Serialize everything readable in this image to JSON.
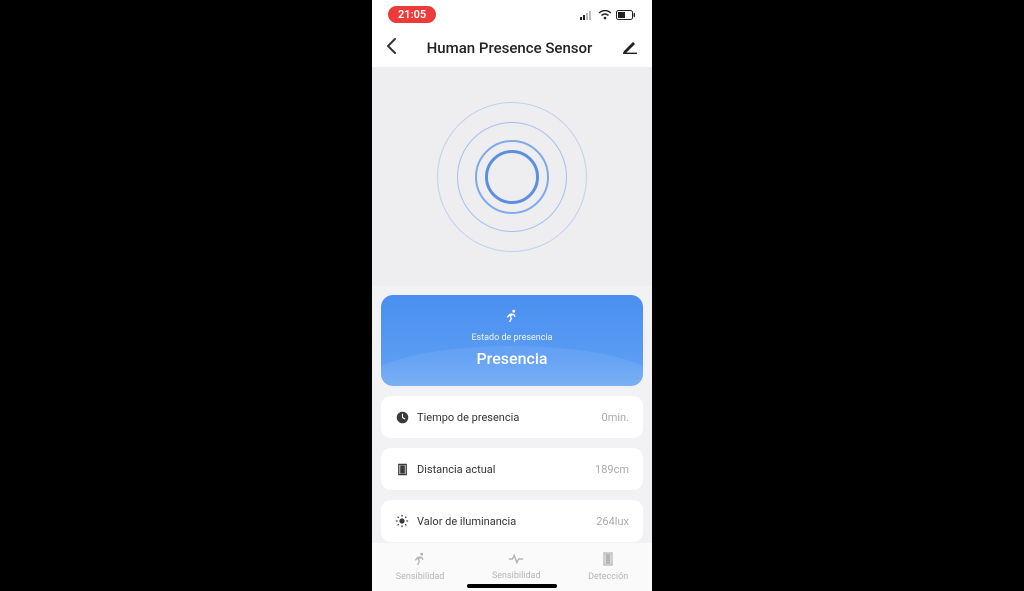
{
  "status_bar": {
    "time": "21:05"
  },
  "nav": {
    "title": "Human Presence Sensor"
  },
  "presence": {
    "label": "Estado de presencia",
    "value": "Presencia"
  },
  "metrics": [
    {
      "icon": "clock",
      "label": "Tiempo de presencia",
      "value": "0min."
    },
    {
      "icon": "door",
      "label": "Distancia actual",
      "value": "189cm"
    },
    {
      "icon": "sun",
      "label": "Valor de iluminancia",
      "value": "264lux"
    }
  ],
  "tabs": [
    {
      "icon": "run",
      "label": "Sensibilidad"
    },
    {
      "icon": "pulse",
      "label": "Sensibilidad"
    },
    {
      "icon": "door",
      "label": "Detección"
    }
  ]
}
